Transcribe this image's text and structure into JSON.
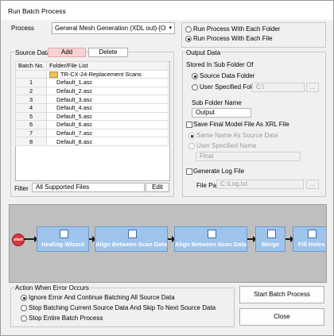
{
  "window": {
    "title": "Run Batch Process"
  },
  "process": {
    "label": "Process",
    "selected": "General Mesh Generation (XDL out)-[Object Sc",
    "option_each_folder": "Run Process With Each Folder",
    "option_each_file": "Run Process With Each File"
  },
  "source": {
    "group_label": "Source Data",
    "add_label": "Add",
    "delete_label": "Delete",
    "headers": [
      "Batch No.",
      "Folder/File List"
    ],
    "folder_name": "TR-CX-24-Replacement Scans",
    "rows": [
      {
        "num": "1",
        "file": "Default_1.asc"
      },
      {
        "num": "2",
        "file": "Default_2.asc"
      },
      {
        "num": "3",
        "file": "Default_3.asc"
      },
      {
        "num": "4",
        "file": "Default_4.asc"
      },
      {
        "num": "5",
        "file": "Default_5.asc"
      },
      {
        "num": "6",
        "file": "Default_6.asc"
      },
      {
        "num": "7",
        "file": "Default_7.asc"
      },
      {
        "num": "8",
        "file": "Default_8.asc"
      }
    ],
    "filter_label": "Filter",
    "filter_value": "All Supported Files",
    "edit_label": "Edit"
  },
  "output": {
    "group_label": "Output Data",
    "store_label": "Stored In Sub Folder Of",
    "source_folder_label": "Source Data Folder",
    "user_folder_label": "User Specified Folder",
    "user_folder_value": "C:\\",
    "browse_label": "...",
    "subfolder_name_label": "Sub Folder Name",
    "subfolder_name_value": "Output",
    "save_xrl_label": "Save Final Model File As XRL File",
    "same_name_label": "Same Name As Source Data",
    "user_name_label": "User Specified Name",
    "user_name_value": "Final",
    "log_label": "Generate Log File",
    "file_path_label": "File Path",
    "file_path_value": "C:\\Log.txt"
  },
  "flow": {
    "start_label": "start",
    "steps": [
      "Healing Wizard",
      "Align Between Scan Data",
      "Align Between Scan Data",
      "Merge",
      "Fill Holes"
    ]
  },
  "error": {
    "group_label": "Action When Error Occurs",
    "options": [
      "Ignore Error And Continue Batching All Source Data",
      "Stop Batching Current Source Data And Skip To Next Source Data",
      "Stop Entire Batch Process"
    ]
  },
  "actions": {
    "start_label": "Start Batch Process",
    "close_label": "Close"
  },
  "colors": {
    "add_button": "#f6d3d3",
    "node_fill": "#7bb0e3",
    "start_node": "#d9383a",
    "flow_bg": "#bfbfbf"
  }
}
